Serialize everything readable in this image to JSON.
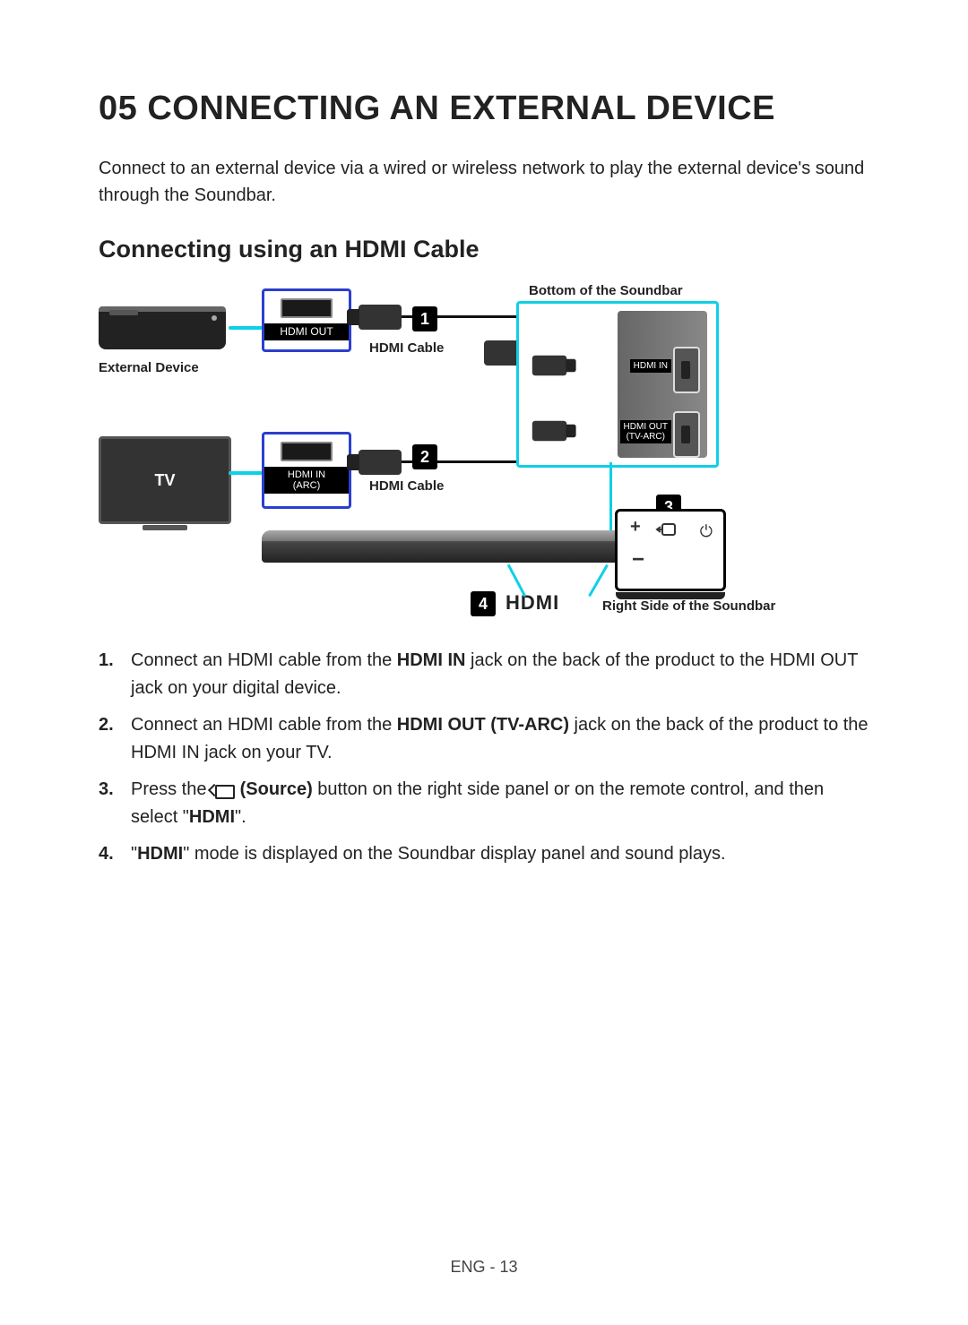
{
  "chapter": {
    "number": "05",
    "title": "CONNECTING AN EXTERNAL DEVICE"
  },
  "intro": "Connect to an external device via a wired or wireless network to play the external device's sound through the Soundbar.",
  "section_title": "Connecting using an HDMI Cable",
  "diagram": {
    "external_device_label": "External Device",
    "tv_label": "TV",
    "port_hdmi_out": "HDMI OUT",
    "port_hdmi_in_arc_line1": "HDMI IN",
    "port_hdmi_in_arc_line2": "(ARC)",
    "hdmi_cable_label": "HDMI Cable",
    "bottom_panel_label": "Bottom of the Soundbar",
    "panel_port_hdmi_in": "HDMI IN",
    "panel_port_hdmi_out_line1": "HDMI OUT",
    "panel_port_hdmi_out_line2": "(TV-ARC)",
    "right_panel_label": "Right Side of the Soundbar",
    "step4_text": "HDMI",
    "badge1": "1",
    "badge2": "2",
    "badge3": "3",
    "badge4": "4",
    "btn_plus": "+",
    "btn_minus": "−",
    "btn_power": "⏻"
  },
  "steps": {
    "s1_num": "1.",
    "s1_a": "Connect an HDMI cable from the ",
    "s1_bold": "HDMI IN",
    "s1_b": " jack on the back of the product to the HDMI OUT jack on your digital device.",
    "s2_num": "2.",
    "s2_a": "Connect an HDMI cable from the ",
    "s2_bold": "HDMI OUT (TV-ARC)",
    "s2_b": " jack on the back of the product to the HDMI IN jack on your TV.",
    "s3_num": "3.",
    "s3_a": "Press the ",
    "s3_bold_source": "(Source)",
    "s3_b": " button on the right side panel or on the remote control, and then select \"",
    "s3_bold_hdmi": "HDMI",
    "s3_c": "\".",
    "s4_num": "4.",
    "s4_a": "\"",
    "s4_bold": "HDMI",
    "s4_b": "\" mode is displayed on the Soundbar display panel and sound plays."
  },
  "footer": "ENG - 13"
}
